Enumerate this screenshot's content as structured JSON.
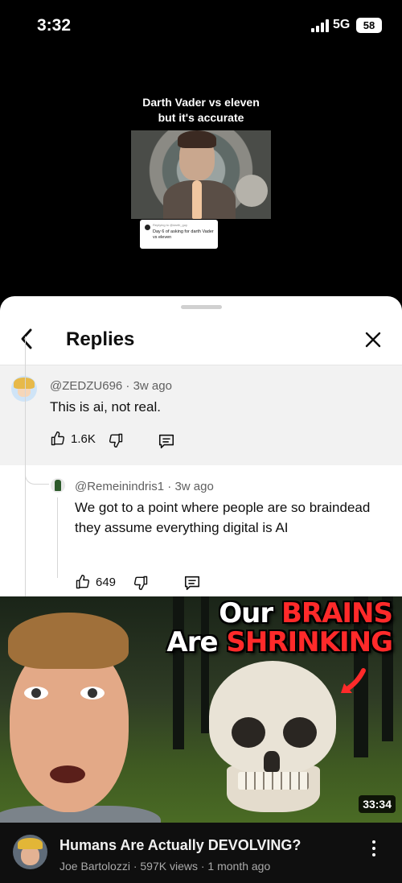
{
  "status_bar": {
    "time": "3:32",
    "network": "5G",
    "battery": "58"
  },
  "video": {
    "caption_line1": "Darth Vader vs eleven",
    "caption_line2": "but it's accurate",
    "sticker_header": "Replying to @darth_guy",
    "sticker_text": "Day 6 of asking for darth Vader vs eleven"
  },
  "sheet": {
    "title": "Replies"
  },
  "parent_comment": {
    "author": "@ZEDZU696",
    "age": "3w ago",
    "text": "This is ai, not real.",
    "likes": "1.6K"
  },
  "reply_comment": {
    "author": "@Remeinindris1",
    "age": "3w ago",
    "text": "We got to a point where people are so braindead they assume everything digital is AI",
    "likes": "649"
  },
  "thumbnail": {
    "headline_our": "Our",
    "headline_brains": "BRAINS",
    "headline_are": "Are",
    "headline_shrinking": "SHRINKING",
    "duration": "33:34"
  },
  "video_info": {
    "title": "Humans Are Actually DEVOLVING?",
    "meta": "Joe Bartolozzi · 597K views · 1 month ago"
  },
  "colors": {
    "headline_red": "#ff2a2a",
    "sheet_bg": "#ffffff",
    "highlight_bg": "#f2f2f2"
  }
}
